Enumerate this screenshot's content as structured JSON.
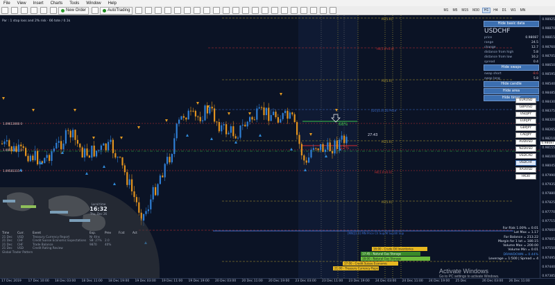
{
  "menu": [
    "File",
    "View",
    "Insert",
    "Charts",
    "Tools",
    "Window",
    "Help"
  ],
  "toolbar": {
    "new_order": "New Order",
    "autotrading": "AutoTrading",
    "timeframes": [
      "M1",
      "M5",
      "M15",
      "M30",
      "H1",
      "H4",
      "D1",
      "W1",
      "MN"
    ],
    "active_timeframe": "H1"
  },
  "chart": {
    "info_line": "Par : 1 stop loss and 2% risk · 66 tote / 0.1k",
    "sl_label_top": "1.09613066 0",
    "sl_label_mid": "1.09594118 0",
    "sl_label_low": "1.09581315 0",
    "hud_percent_top": "68%",
    "hud_percent_bottom": "12%",
    "time_label": "27:43",
    "level_h1_a": "H1[1.0]",
    "level_h4": "H4[1.0+0.4]",
    "level_h1_b": "H1[1.0]",
    "level_d1_high": "[D1][1.0] D1 Price",
    "level_h1_mid": "H1[1.0]",
    "level_h4_low": "H4[1.0+0.4]",
    "level_h1_c": "H1[1.0]",
    "level_h1_d": "H1[1.0]",
    "level_mn": "[MN][1.0] MN Price Ch Sup/M Sup/W Sup",
    "colors": {
      "bull": "#2f7fd6",
      "bear": "#e3941f",
      "arrow_up": "#2f8ad8",
      "arrow_down": "#e39a22",
      "green_line": "#39c24a",
      "red_line": "#d42b2b"
    }
  },
  "price_axis": [
    "0.98925",
    "0.98870",
    "0.98815",
    "0.98760",
    "0.98705",
    "0.98650",
    "0.98595",
    "0.98540",
    "0.98485",
    "0.98430",
    "0.98375",
    "0.98320",
    "0.98265",
    "0.98210",
    "0.98155",
    "0.98100",
    "0.98045",
    "0.97990",
    "0.97935",
    "0.97880",
    "0.97825",
    "0.97770",
    "0.97715",
    "0.97660",
    "0.97605",
    "0.97550",
    "0.97495",
    "0.97440",
    "0.97385"
  ],
  "price_current": "0.98087",
  "date_axis": [
    "17 Dec 2019",
    "17 Dec 10:00",
    "18 Dec 03:00",
    "18 Dec 11:00",
    "18 Dec 19:00",
    "19 Dec 03:00",
    "19 Dec 11:00",
    "19 Dec 19:00",
    "20 Dec 03:00",
    "20 Dec 11:00",
    "20 Dec 19:00",
    "23 Dec 03:00",
    "23 Dec 11:00",
    "23 Dec 19:00",
    "24 Dec 03:00",
    "24 Dec 11:00",
    "24 Dec 19:00",
    "25 Dec",
    "26 Dec 03:00",
    "26 Dec 11:00"
  ],
  "right_panel": {
    "hide_basic": "Hide basic data",
    "symbol": "USDCHF",
    "rows": [
      {
        "label": "price",
        "value": "0.98087"
      },
      {
        "label": "range",
        "value": "24.5"
      },
      {
        "label": "change",
        "value": "12.7"
      },
      {
        "label": "distance from high",
        "value": "5.8"
      },
      {
        "label": "distance from low",
        "value": "16.2"
      },
      {
        "label": "spread",
        "value": "0.4"
      }
    ],
    "hide_swaps": "Hide swaps",
    "swap_rows": [
      {
        "label": "swap short",
        "value": "-8.6"
      },
      {
        "label": "swap long",
        "value": "5.8"
      }
    ],
    "hide_candle": "Hide candle",
    "hide_area": "Hide area",
    "hide_timer": "Hide timer"
  },
  "symbols": [
    "EURUSD",
    "GBPUSD",
    "USDJPY",
    "EURJPY",
    "GBPJPY",
    "CADJPY",
    "AUDUSD",
    "NZDUSD",
    "USDCAD",
    "USDCHF",
    "XAUUSD",
    "HK30"
  ],
  "active_symbol": "USDCHF",
  "clock": {
    "label": "Local time",
    "time": "16:32",
    "date": "Thu, Dec 26"
  },
  "terminal": {
    "headers": [
      "Time",
      "Curr.",
      "Event",
      "Exp.",
      "Prev",
      "Fcst",
      "Act"
    ],
    "rows": [
      [
        "21 Dec",
        "USD",
        "Treasury Currency Report",
        "Nr 4Ins",
        "",
        "",
        ""
      ],
      [
        "21 Dec",
        "CHF",
        "Credit Suisse Economic Expectations",
        "SB: 27%",
        "2.0",
        "",
        ""
      ],
      [
        "21 Dec",
        "CHF",
        "Trade Balance",
        "9870",
        "40%",
        "",
        ""
      ],
      [
        "21 Dec",
        "USD",
        "Credit Rating Review",
        "",
        "",
        "",
        ""
      ]
    ],
    "footer": "Global Trader Pattern"
  },
  "events": [
    {
      "time": "16:00",
      "label": "Crude Oil Inventories"
    },
    {
      "time": "17:45",
      "label": "Natural Gas Storage"
    },
    {
      "time": "18:00",
      "label": "Natural Gas Storage"
    },
    {
      "time": "17:00",
      "label": "Credit Suisse Economic"
    },
    {
      "time": "21:00",
      "label": "Treasury Currency Repo"
    }
  ],
  "stats": [
    "For Risk 1.00% = 0.01",
    "Lot Max = 1.17",
    "For Balance = 213.22",
    "Margin for 1 lot = 180.15",
    "Volume Max = 200.00",
    "Volume Min = 0.01",
    "DRAWDOWN = 0.44%",
    "Leverage = 1:500 | Spread = 4"
  ],
  "watermark": {
    "line1": "Activate Windows",
    "line2": "Go to PC settings to activate Windows."
  }
}
